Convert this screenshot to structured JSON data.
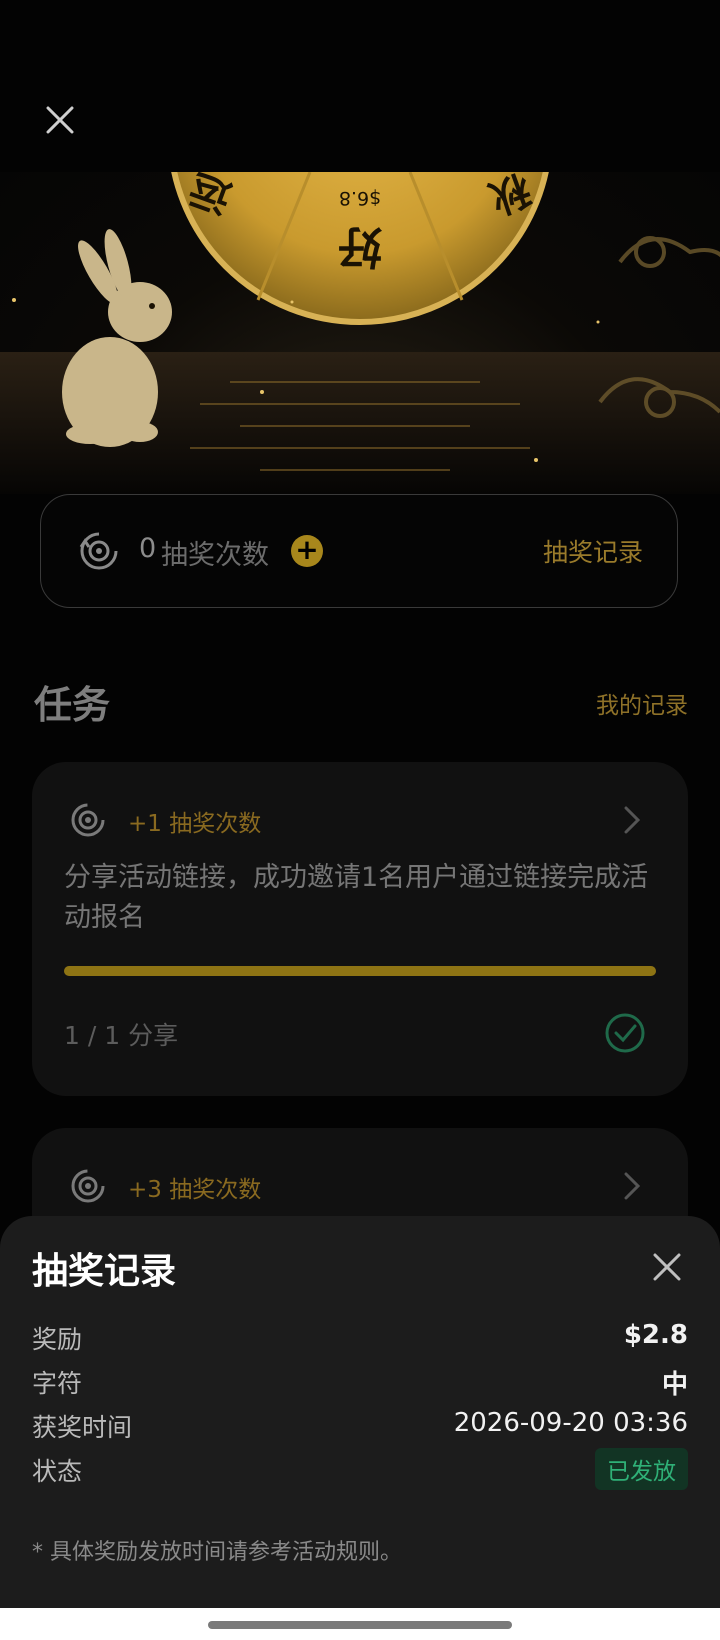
{
  "wheel": {
    "prize_top": "$6.8",
    "char_center": "好",
    "char_left": "运",
    "char_right": "秋"
  },
  "counter": {
    "count": "0",
    "label": "抽奖次数",
    "records_link": "抽奖记录"
  },
  "tasks": {
    "title": "任务",
    "my_records": "我的记录",
    "items": [
      {
        "reward": "+1 抽奖次数",
        "description": "分享活动链接，成功邀请1名用户通过链接完成活动报名",
        "progress_text": "1 / 1 分享",
        "progress": 1.0,
        "completed": true
      },
      {
        "reward": "+3 抽奖次数"
      }
    ]
  },
  "sheet": {
    "title": "抽奖记录",
    "rows": [
      {
        "key": "奖励",
        "value": "$2.8"
      },
      {
        "key": "字符",
        "value": "中"
      },
      {
        "key": "获奖时间",
        "value": "2026-09-20 03:36"
      },
      {
        "key": "状态",
        "value": "已发放"
      }
    ],
    "note": "* 具体奖励发放时间请参考活动规则。"
  },
  "colors": {
    "gold": "#a8871c",
    "status_green": "#2fb077",
    "sheet_bg": "#1c1c1c"
  }
}
